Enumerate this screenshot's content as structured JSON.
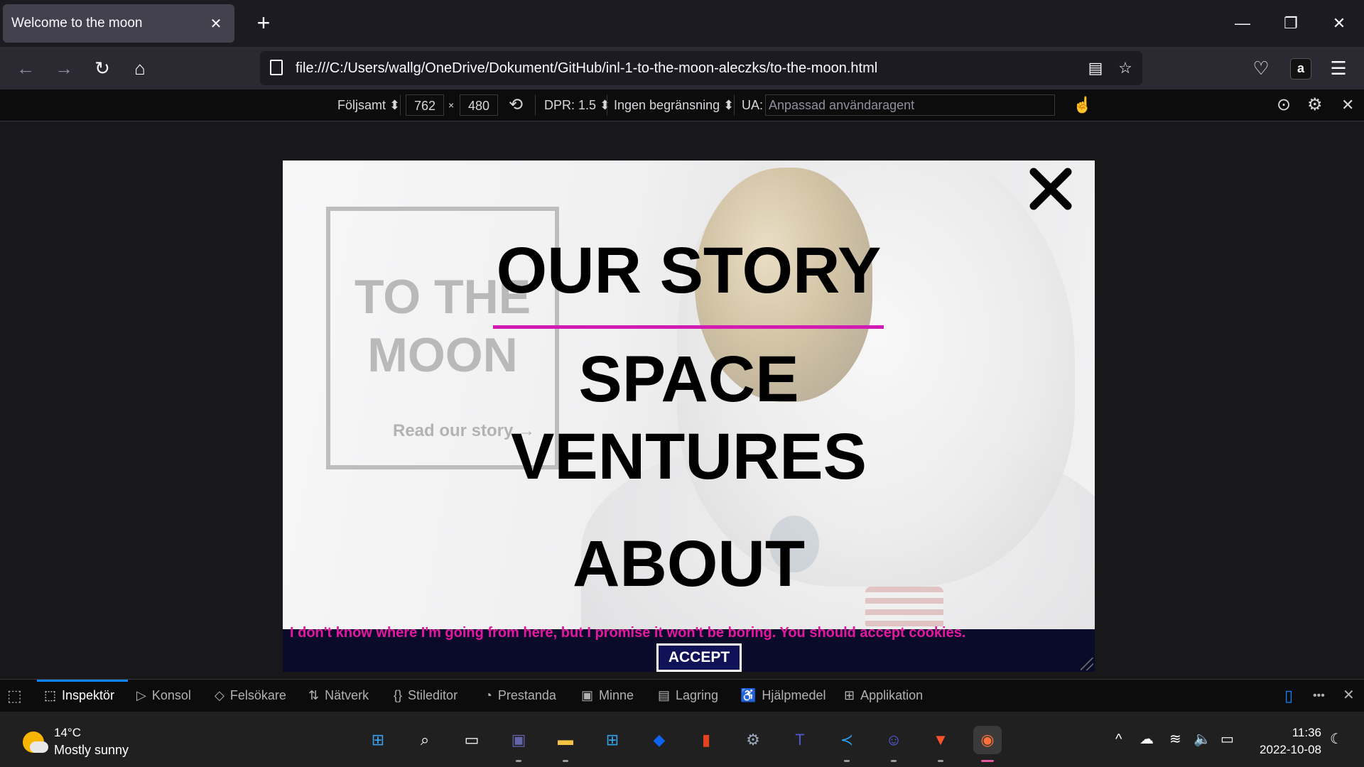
{
  "browser": {
    "tab_title": "Welcome to the moon",
    "tab_close_glyph": "✕",
    "new_tab_glyph": "+",
    "window_controls": {
      "minimize": "—",
      "restore": "❐",
      "close": "✕"
    },
    "url": "file:///C:/Users/wallg/OneDrive/Dokument/GitHub/inl-1-to-the-moon-aleczks/to-the-moon.html",
    "nav_glyphs": {
      "back": "←",
      "forward": "→",
      "reload": "↻",
      "home": "⌂",
      "reader": "▤",
      "bookmark": "☆",
      "pocket": "♡",
      "menu": "☰",
      "amazon": "a"
    }
  },
  "rdm": {
    "device": "Följsamt ⬍",
    "width": "762",
    "times": "×",
    "height": "480",
    "rotate_glyph": "⟲",
    "dpr": "DPR: 1.5 ⬍",
    "throttle": "Ingen begränsning ⬍",
    "ua_label": "UA:",
    "ua_placeholder": "Anpassad användaragent",
    "touch_glyph": "☝",
    "screenshot_glyph": "⊙",
    "settings_glyph": "⚙",
    "close_glyph": "✕"
  },
  "page": {
    "hero": {
      "title_line1": "TO THE",
      "title_line2": "MOON",
      "link": "Read our story →"
    },
    "menu": {
      "item1": "OUR STORY",
      "item2": "SPACE",
      "item3": "VENTURES",
      "item4": "ABOUT"
    },
    "cookie": {
      "text": "I don't know where I'm going from here, but I promise it won't be boring. You should accept cookies.",
      "accept_label": "ACCEPT"
    },
    "colors": {
      "accent": "#d21bb1",
      "cookie_text": "#e3189f",
      "cookie_bg": "#0a0a2a",
      "accept_bg": "#0f1257"
    }
  },
  "devtools": {
    "pick_glyph": "⬚",
    "tabs": [
      {
        "icon": "⬚",
        "label": "Inspektör"
      },
      {
        "icon": "▷",
        "label": "Konsol"
      },
      {
        "icon": "◇",
        "label": "Felsökare"
      },
      {
        "icon": "⇅",
        "label": "Nätverk"
      },
      {
        "icon": "{}",
        "label": "Stileditor"
      },
      {
        "icon": "◔",
        "label": "Prestanda"
      },
      {
        "icon": "▣",
        "label": "Minne"
      },
      {
        "icon": "▤",
        "label": "Lagring"
      },
      {
        "icon": "♿",
        "label": "Hjälpmedel"
      },
      {
        "icon": "⊞",
        "label": "Applikation"
      }
    ],
    "right_glyphs": {
      "rdm_toggle": "▯",
      "more": "•••",
      "close": "✕"
    }
  },
  "taskbar": {
    "weather": {
      "temp": "14°C",
      "desc": "Mostly sunny"
    },
    "apps": [
      {
        "name": "start",
        "glyph": "⊞",
        "color": "#3aa0f3"
      },
      {
        "name": "search",
        "glyph": "⌕",
        "color": "#ffffff"
      },
      {
        "name": "task-view",
        "glyph": "▭",
        "color": "#ffffff"
      },
      {
        "name": "chat",
        "glyph": "▣",
        "color": "#6264a7"
      },
      {
        "name": "file-explorer",
        "glyph": "▬",
        "color": "#f4c343"
      },
      {
        "name": "store",
        "glyph": "⊞",
        "color": "#35a3e8"
      },
      {
        "name": "dropbox",
        "glyph": "◆",
        "color": "#0d63f2"
      },
      {
        "name": "office",
        "glyph": "▮",
        "color": "#e3431e"
      },
      {
        "name": "settings",
        "glyph": "⚙",
        "color": "#9aa8b8"
      },
      {
        "name": "teams",
        "glyph": "T",
        "color": "#5059c9"
      },
      {
        "name": "vscode",
        "glyph": "≺",
        "color": "#2d9ee8"
      },
      {
        "name": "discord",
        "glyph": "☺",
        "color": "#5865f2"
      },
      {
        "name": "brave",
        "glyph": "▼",
        "color": "#fb542b"
      },
      {
        "name": "firefox",
        "glyph": "◉",
        "color": "#ff7139"
      }
    ],
    "tray": {
      "chevron": "^",
      "cloud": "☁",
      "wifi": "≋",
      "volume": "🔈",
      "battery": "▭",
      "moon": "☾"
    },
    "clock": {
      "time": "11:36",
      "date": "2022-10-08"
    }
  }
}
